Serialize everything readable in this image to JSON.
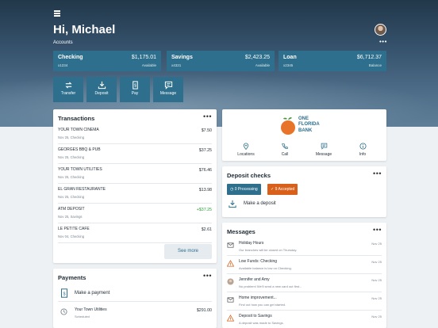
{
  "header": {
    "greeting": "Hi, Michael",
    "accounts_label": "Accounts",
    "more_label": "•••"
  },
  "accounts": [
    {
      "name": "Checking",
      "number": "x1234",
      "amount": "$1,175.01",
      "sub": "Available"
    },
    {
      "name": "Savings",
      "number": "x4321",
      "amount": "$2,423.25",
      "sub": "Available"
    },
    {
      "name": "Loan",
      "number": "x2345",
      "amount": "$6,712.37",
      "sub": "Balance"
    }
  ],
  "quick_actions": [
    {
      "label": "Transfer",
      "icon": "transfer-icon"
    },
    {
      "label": "Deposit",
      "icon": "deposit-icon"
    },
    {
      "label": "Pay",
      "icon": "pay-icon"
    },
    {
      "label": "Message",
      "icon": "message-icon"
    }
  ],
  "transactions": {
    "title": "Transactions",
    "more_label": "•••",
    "items": [
      {
        "name": "YOUR TOWN CINEMA",
        "date": "Nov 25, Checking",
        "amount": "$7.50",
        "positive": false
      },
      {
        "name": "GEORGES BBQ & PUB",
        "date": "Nov 25, Checking",
        "amount": "$37.25",
        "positive": false
      },
      {
        "name": "YOUR TOWN UTILITIES",
        "date": "Nov 25, Checking",
        "amount": "$76.46",
        "positive": false
      },
      {
        "name": "EL GRAN RESTAURANTE",
        "date": "Nov 25, Checking",
        "amount": "$13.98",
        "positive": false
      },
      {
        "name": "ATM DEPOSIT",
        "date": "Nov 25, Savings",
        "amount": "+$37.25",
        "positive": true
      },
      {
        "name": "LE PETITE CAFE",
        "date": "Nov 04, Checking",
        "amount": "$2.61",
        "positive": false
      }
    ],
    "see_more": "See more"
  },
  "payments": {
    "title": "Payments",
    "more_label": "•••",
    "make_payment": "Make a payment",
    "items": [
      {
        "name": "Your Town Utilities",
        "status": "Scheduled",
        "amount": "$291.00"
      }
    ]
  },
  "bank": {
    "name_line1": "ONE",
    "name_line2": "FLORIDA",
    "name_line3": "BANK",
    "colors": {
      "brand": "#2d6f8c",
      "orange": "#e8742a",
      "leaf": "#4a9a3c"
    },
    "actions": [
      {
        "label": "Locations",
        "icon": "location-pin-icon"
      },
      {
        "label": "Call",
        "icon": "phone-icon"
      },
      {
        "label": "Message",
        "icon": "message-icon"
      },
      {
        "label": "Info",
        "icon": "info-icon"
      }
    ]
  },
  "deposit_checks": {
    "title": "Deposit checks",
    "more_label": "•••",
    "processing": "0 Processing",
    "accepted": "9 Accepted",
    "make_deposit": "Make a deposit"
  },
  "messages": {
    "title": "Messages",
    "more_label": "•••",
    "items": [
      {
        "title": "Holiday Hours",
        "preview": "Our branches will be closed on Thursday.",
        "date": "Nov 25",
        "icon": "envelope-icon"
      },
      {
        "title": "Low Funds: Checking",
        "preview": "Available balance is low on Checking.",
        "date": "Nov 25",
        "icon": "warning-icon"
      },
      {
        "title": "Jennifer and Amy",
        "preview": "No problem! We'll send a new card out first...",
        "date": "Nov 25",
        "icon": "avatar-icon"
      },
      {
        "title": "Home improvement...",
        "preview": "Find out how you can get started.",
        "date": "Nov 25",
        "icon": "envelope-icon"
      },
      {
        "title": "Deposit to Savings",
        "preview": "A deposit was made to Savings.",
        "date": "Nov 25",
        "icon": "warning-icon"
      }
    ]
  }
}
